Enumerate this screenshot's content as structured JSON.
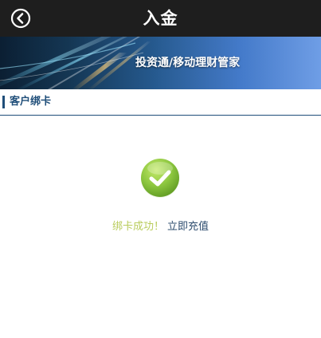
{
  "header": {
    "title": "入金",
    "back_icon": "chevron-left-circle-icon"
  },
  "banner": {
    "text": "投资通/移动理财管家"
  },
  "section": {
    "title": "客户绑卡"
  },
  "result": {
    "icon": "check-circle-icon",
    "success_text": "绑卡成功！",
    "action_link": "立即充值"
  },
  "colors": {
    "topbar_bg": "#1e1e1e",
    "section_accent": "#1f4e79",
    "success_text": "#b9cc5c",
    "link_text": "#2d4c6e",
    "check_green": "#8cc63f"
  }
}
